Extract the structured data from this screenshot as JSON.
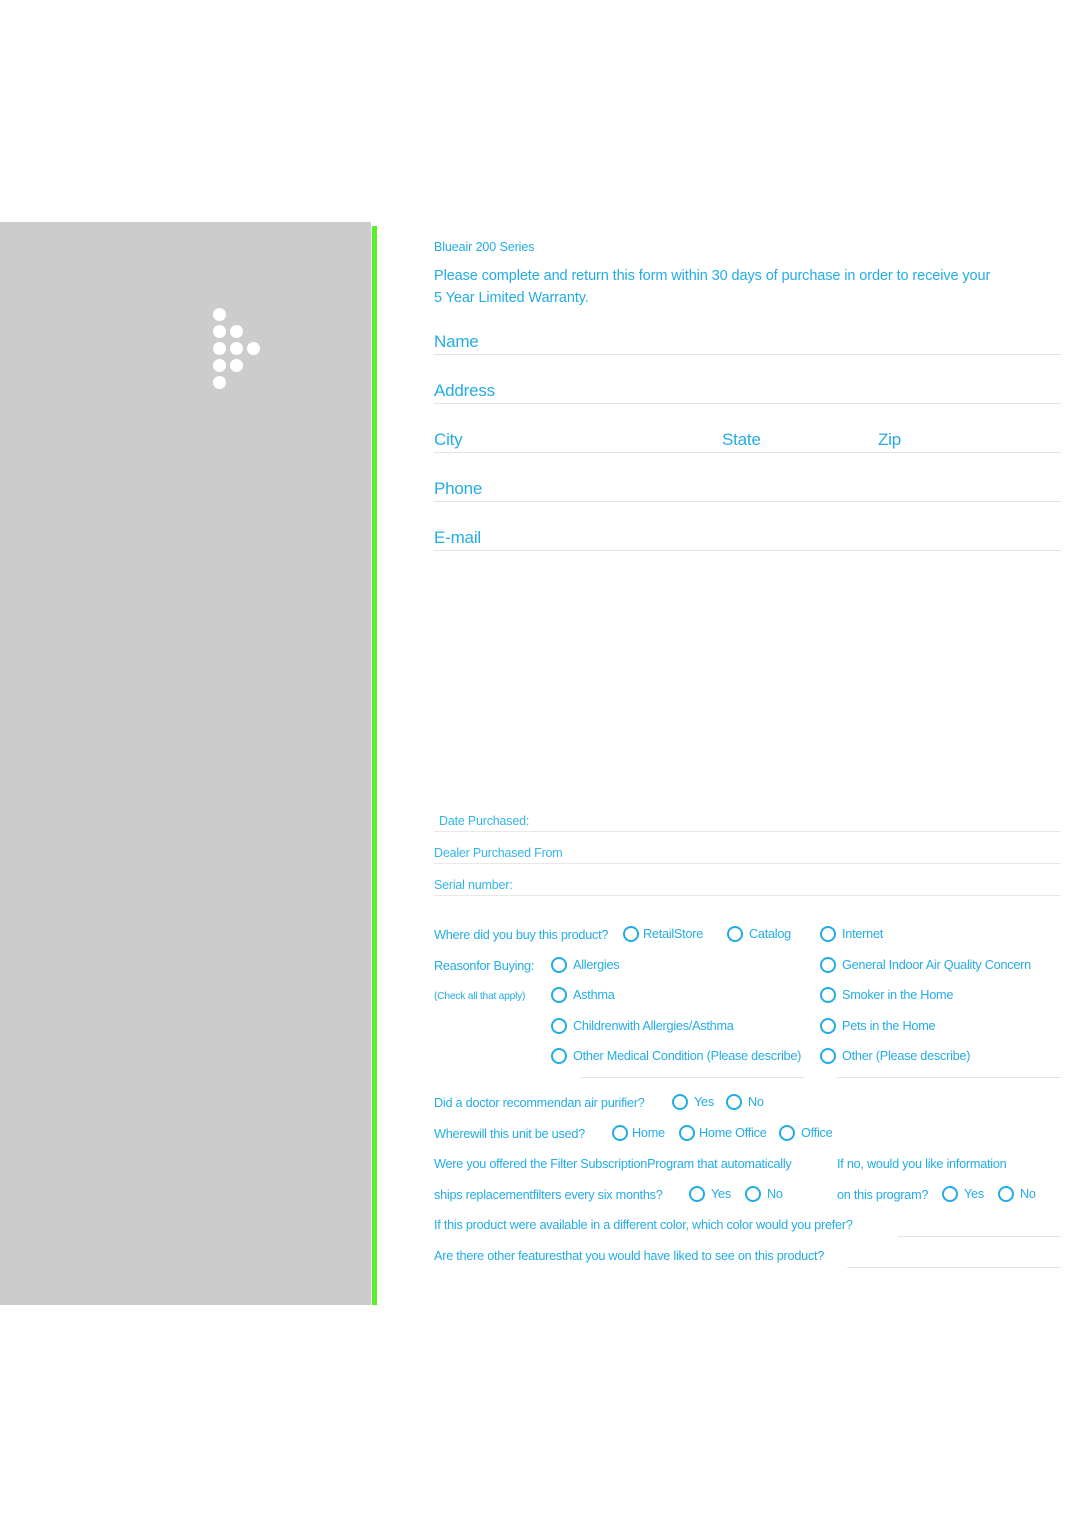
{
  "theme": {
    "accent_blue": "#24ace5",
    "panel_gray": "#cccccc",
    "stripe_green": "#5aee2a",
    "rule_gray": "#e2e2e2"
  },
  "brand": {
    "logo_name": "blueair-dot-arrow-logo"
  },
  "intro": {
    "product": "Blueair 200 Series",
    "line1": "Please complete and return this form within 30 days of purchase in order to receive your",
    "line2": "5 Year Limited Warranty."
  },
  "contact_fields": [
    {
      "label": "Name"
    },
    {
      "label": "Address"
    },
    {
      "label": "City",
      "label2": "State",
      "label3": "Zip"
    },
    {
      "label": "Phone"
    },
    {
      "label": "E-mail"
    }
  ],
  "purchase_fields": [
    {
      "label": "Date Purchased:"
    },
    {
      "label": "Dealer Purchased From"
    },
    {
      "label": "Serial number:"
    }
  ],
  "survey": {
    "where_buy": {
      "question": "Where did you buy this product?",
      "options": [
        "RetailStore",
        "Catalog",
        "Internet"
      ]
    },
    "reason": {
      "question": "Reasonfor Buying:",
      "note": "(Check all that apply)",
      "left_options": [
        "Allergies",
        "Asthma",
        "Childrenwith Allergies/Asthma",
        "Other Medical Condition (Please describe)"
      ],
      "right_options": [
        "General Indoor Air Quality Concern",
        "Smoker in the Home",
        "Pets in the Home",
        "Other (Please describe)"
      ]
    },
    "doctor": {
      "question": "Did a doctor recommendan air purifier?",
      "options": [
        "Yes",
        "No"
      ]
    },
    "usage": {
      "question": "Wherewill this unit be used?",
      "options": [
        "Home",
        "Home Office",
        "Office"
      ]
    },
    "subscription": {
      "question_line1": "Were you offered the Filter SubscriptionProgram that automatically",
      "question_line2": "ships replacementfilters every six months?",
      "options": [
        "Yes",
        "No"
      ],
      "followup_line1": "If no, would you like information",
      "followup_line2": "on this program?",
      "followup_options": [
        "Yes",
        "No"
      ]
    },
    "color_question": "If this product were available in a different color, which color would you prefer?",
    "features_question": "Are there other featuresthat you would have liked to see on this product?"
  }
}
